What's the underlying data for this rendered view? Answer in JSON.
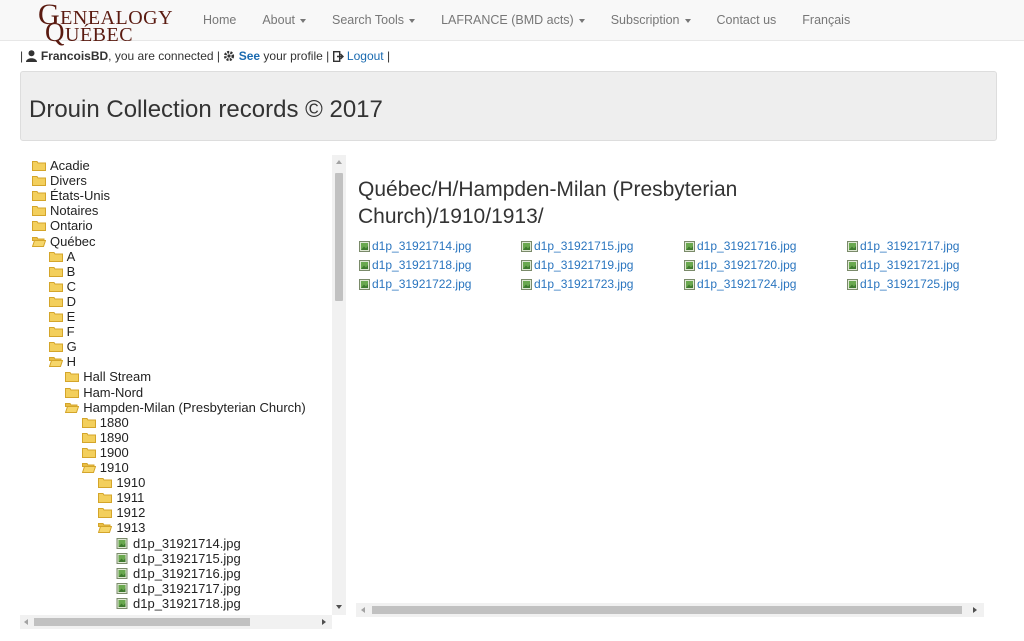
{
  "logo": {
    "line1_cap": "G",
    "line1_rest": "ENEALOGY",
    "line2_cap": "Q",
    "line2_rest": "UÉBEC"
  },
  "nav": {
    "home": "Home",
    "about": "About",
    "search_tools": "Search Tools",
    "lafrance": "LAFRANCE (BMD acts)",
    "subscription": "Subscription",
    "contact": "Contact us",
    "language": "Français"
  },
  "userbar": {
    "sep": "|",
    "username": "FrancoisBD",
    "connected": ", you are connected |",
    "see": "See",
    "profile": "your profile |",
    "logout": "Logout",
    "end": "|"
  },
  "page": {
    "title": "Drouin Collection records © 2017"
  },
  "tree": [
    {
      "label": "Acadie",
      "open": false,
      "file": false
    },
    {
      "label": "Divers",
      "open": false,
      "file": false
    },
    {
      "label": "États-Unis",
      "open": false,
      "file": false
    },
    {
      "label": "Notaires",
      "open": false,
      "file": false
    },
    {
      "label": "Ontario",
      "open": false,
      "file": false
    },
    {
      "label": "Québec",
      "open": true,
      "file": false
    },
    {
      "label": "A",
      "open": false,
      "file": false
    },
    {
      "label": "B",
      "open": false,
      "file": false
    },
    {
      "label": "C",
      "open": false,
      "file": false
    },
    {
      "label": "D",
      "open": false,
      "file": false
    },
    {
      "label": "E",
      "open": false,
      "file": false
    },
    {
      "label": "F",
      "open": false,
      "file": false
    },
    {
      "label": "G",
      "open": false,
      "file": false
    },
    {
      "label": "H",
      "open": true,
      "file": false
    },
    {
      "label": "Hall Stream",
      "open": false,
      "file": false
    },
    {
      "label": "Ham-Nord",
      "open": false,
      "file": false
    },
    {
      "label": "Hampden-Milan (Presbyterian Church)",
      "open": true,
      "file": false
    },
    {
      "label": "1880",
      "open": false,
      "file": false
    },
    {
      "label": "1890",
      "open": false,
      "file": false
    },
    {
      "label": "1900",
      "open": false,
      "file": false
    },
    {
      "label": "1910",
      "open": true,
      "file": false
    },
    {
      "label": "1910",
      "open": false,
      "file": false
    },
    {
      "label": "1911",
      "open": false,
      "file": false
    },
    {
      "label": "1912",
      "open": false,
      "file": false
    },
    {
      "label": "1913",
      "open": true,
      "file": false
    },
    {
      "label": "d1p_31921714.jpg",
      "open": false,
      "file": true
    },
    {
      "label": "d1p_31921715.jpg",
      "open": false,
      "file": true
    },
    {
      "label": "d1p_31921716.jpg",
      "open": false,
      "file": true
    },
    {
      "label": "d1p_31921717.jpg",
      "open": false,
      "file": true
    },
    {
      "label": "d1p_31921718.jpg",
      "open": false,
      "file": true
    }
  ],
  "main": {
    "path": "Québec/H/Hampden-Milan (Presbyterian Church)/1910/1913/",
    "files": [
      "d1p_31921714.jpg",
      "d1p_31921715.jpg",
      "d1p_31921716.jpg",
      "d1p_31921717.jpg",
      "d1p_31921718.jpg",
      "d1p_31921719.jpg",
      "d1p_31921720.jpg",
      "d1p_31921721.jpg",
      "d1p_31921722.jpg",
      "d1p_31921723.jpg",
      "d1p_31921724.jpg",
      "d1p_31921725.jpg"
    ]
  },
  "colors": {
    "folder": "#f0c94a",
    "link": "#2a75bf",
    "logo": "#5a1a10"
  }
}
